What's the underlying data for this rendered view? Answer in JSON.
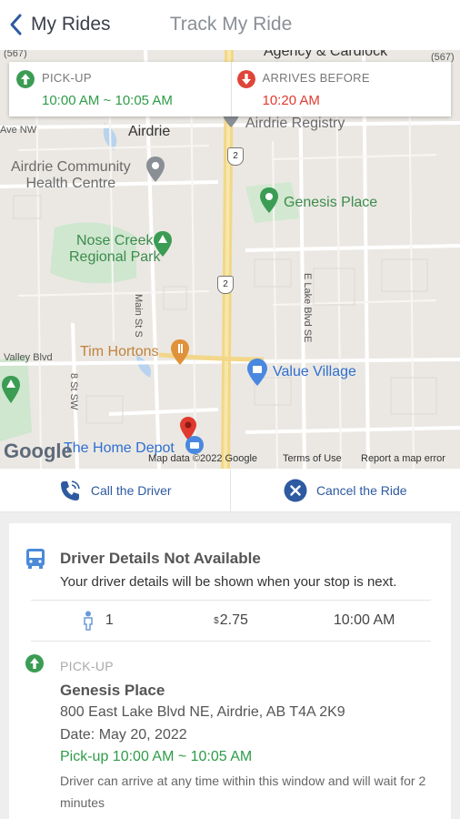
{
  "header": {
    "back_label": "My Rides",
    "title": "Track My Ride"
  },
  "map": {
    "labels": {
      "agency": "Agency & Cardlock",
      "airdrie": "Airdrie",
      "ave_nw": "Ave NW",
      "registry": "Airdrie Registry",
      "health_centre": "Airdrie Community\nHealth Centre",
      "genesis_place": "Genesis Place",
      "nose_creek": "Nose Creek\nRegional Park",
      "main_st": "Main St S",
      "e_lake": "E Lake Blvd SE",
      "tim_hortons": "Tim Hortons",
      "value_village": "Value Village",
      "valley_blvd": "Valley Blvd",
      "eighth_st": "8 St SW",
      "home_depot": "The Home Depot"
    },
    "shields": {
      "hwy2": "2",
      "r567a": "(567)",
      "r567b": "(567)"
    },
    "attribution": {
      "logo": "Google",
      "map_data": "Map data ©2022 Google",
      "terms": "Terms of Use",
      "report": "Report a map error"
    }
  },
  "info": {
    "pickup_label": "PICK-UP",
    "pickup_time": "10:00 AM ~ 10:05 AM",
    "arrives_label": "ARRIVES BEFORE",
    "arrives_time": "10:20 AM"
  },
  "actions": {
    "call": "Call the Driver",
    "cancel": "Cancel the Ride"
  },
  "driver": {
    "title": "Driver Details Not Available",
    "subtitle": "Your driver details will be shown when your stop is next."
  },
  "stats": {
    "passengers": "1",
    "fare_currency": "$",
    "fare": "2.75",
    "time": "10:00 AM"
  },
  "pickup": {
    "label": "PICK-UP",
    "name": "Genesis Place",
    "address": "800 East Lake Blvd NE, Airdrie, AB T4A 2K9",
    "date": "Date: May 20, 2022",
    "window": "Pick-up 10:00 AM ~ 10:05 AM",
    "note": "Driver can arrive at any time within this window and will wait for 2 minutes"
  },
  "colors": {
    "green": "#2e9c48",
    "red": "#e03a2f",
    "blue": "#2d5aa0"
  }
}
